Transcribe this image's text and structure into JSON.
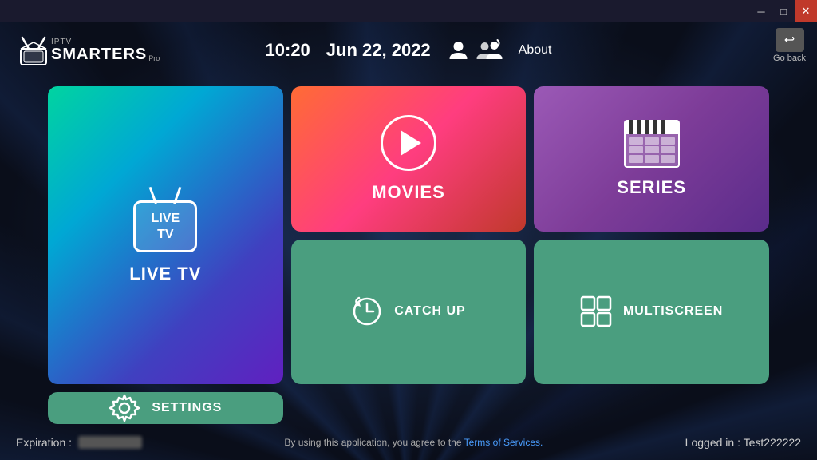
{
  "window": {
    "min_btn": "─",
    "max_btn": "□",
    "close_btn": "✕"
  },
  "header": {
    "logo": {
      "iptv_label": "IPTV",
      "smarters_label": "SMARTERS",
      "pro_label": "Pro"
    },
    "time": "10:20",
    "date": "Jun 22, 2022",
    "about_label": "About"
  },
  "go_back": {
    "label": "Go back",
    "icon": "↩"
  },
  "tiles": {
    "live_tv": {
      "screen_line1": "LIVE",
      "screen_line2": "TV",
      "label": "LIVE TV"
    },
    "movies": {
      "label": "MOVIES"
    },
    "series": {
      "label": "SERIES"
    },
    "catchup": {
      "label": "CATCH UP"
    },
    "multiscreen": {
      "label": "MULTISCREEN"
    },
    "settings": {
      "label": "SETTINGS"
    }
  },
  "footer": {
    "expiration_label": "Expiration :",
    "terms_text": "By using this application, you agree to the",
    "terms_link": "Terms of Services.",
    "logged_in": "Logged in : Test222222"
  }
}
